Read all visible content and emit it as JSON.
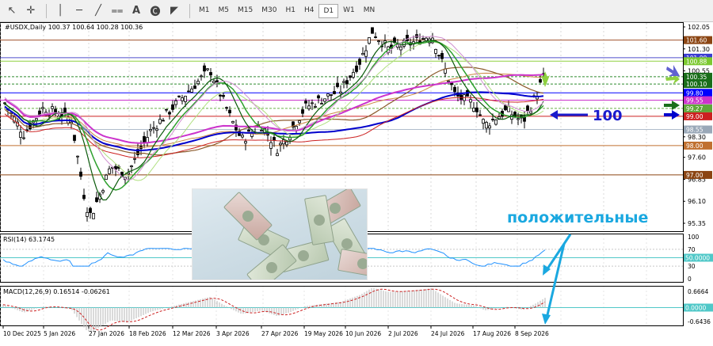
{
  "toolbar": {
    "timeframes": [
      "M1",
      "M5",
      "M15",
      "M30",
      "H1",
      "H4",
      "D1",
      "W1",
      "MN"
    ],
    "active": "D1",
    "tools": [
      "cursor-icon",
      "crosshair-icon",
      "vertical-line-icon",
      "horizontal-line-icon",
      "trendline-icon",
      "channel-icon",
      "text-icon",
      "label-icon",
      "shapes-icon"
    ]
  },
  "chart": {
    "symbol_line": "#USDX,Daily  100.37 100.64 100.28 100.36",
    "price_axis": [
      "102.05",
      "101.30",
      "100.55",
      "99.80",
      "99.05",
      "98.30",
      "97.60",
      "96.85",
      "96.10",
      "95.35"
    ],
    "price_labels": [
      {
        "text": "101.60",
        "color": "#8b4513"
      },
      {
        "text": "101.00",
        "color": "#3b3bd1"
      },
      {
        "text": "100.88",
        "color": "#7cc930"
      },
      {
        "text": "100.35",
        "color": "#1a6e1a"
      },
      {
        "text": "100.10",
        "color": "#1a6e1a"
      },
      {
        "text": "99.80",
        "color": "#0000ff"
      },
      {
        "text": "99.55",
        "color": "#cc33cc"
      },
      {
        "text": "99.27",
        "color": "#5fa83a"
      },
      {
        "text": "99.00",
        "color": "#cc2020"
      },
      {
        "text": "98.55",
        "color": "#9aa8b8"
      },
      {
        "text": "98.00",
        "color": "#c07030"
      },
      {
        "text": "97.00",
        "color": "#8b4513"
      }
    ],
    "annotation_100": "100",
    "annotation_text": "положительные"
  },
  "rsi": {
    "label": "RSI(14) 63.1745",
    "axis": [
      "100",
      "70",
      "50",
      "30",
      "0"
    ],
    "current_label": "50.0000"
  },
  "macd": {
    "label": "MACD(12,26,9) 0.16514 -0.06261",
    "axis": [
      "0.6664",
      "-0.6436"
    ],
    "current_label": "0.0000"
  },
  "time_axis": [
    "10 Dec 2025",
    "5 Jan 2026",
    "27 Jan 2026",
    "18 Feb 2026",
    "12 Mar 2026",
    "3 Apr 2026",
    "27 Apr 2026",
    "19 May 2026",
    "10 Jun 2026",
    "2 Jul 2026",
    "24 Jul 2026",
    "17 Aug 2026",
    "8 Sep 2026"
  ]
}
